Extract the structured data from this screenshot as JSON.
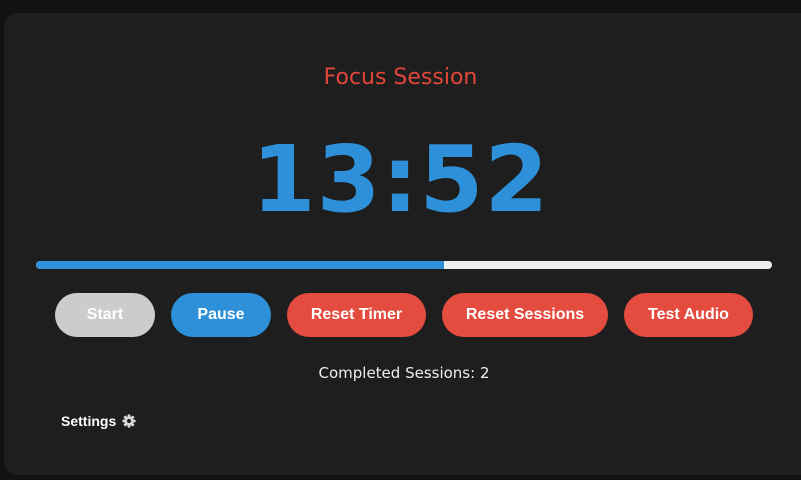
{
  "session": {
    "title": "Focus Session",
    "time_remaining": "13:52",
    "progress_fraction": 0.555
  },
  "controls": {
    "start_label": "Start",
    "pause_label": "Pause",
    "reset_timer_label": "Reset Timer",
    "reset_sessions_label": "Reset Sessions",
    "test_audio_label": "Test Audio"
  },
  "stats": {
    "completed_sessions_text": "Completed Sessions: 2"
  },
  "settings": {
    "label": "Settings",
    "icon": "gear-icon"
  },
  "colors": {
    "accent_blue": "#2e90d8",
    "accent_red": "#e34c3f",
    "disabled_gray": "#cccccc",
    "card_background": "#1e1e1e"
  }
}
